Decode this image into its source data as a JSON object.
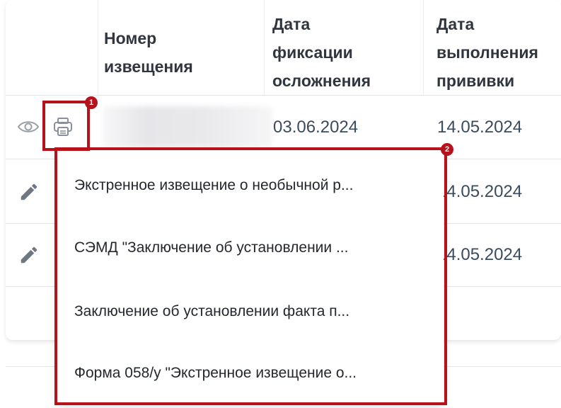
{
  "table": {
    "headers": {
      "number": [
        "Номер",
        "извещения"
      ],
      "fix_date": [
        "Дата",
        "фиксации",
        "осложнения"
      ],
      "vacc_date": [
        "Дата",
        "выполнения",
        "прививки"
      ]
    },
    "rows": [
      {
        "fix_date": "03.06.2024",
        "vacc_date": "14.05.2024"
      },
      {
        "vacc_date": "14.05.2024"
      },
      {
        "vacc_date": "14.05.2024"
      }
    ]
  },
  "callouts": {
    "one": "1",
    "two": "2"
  },
  "print_menu": {
    "items": [
      "Экстренное извещение о необычной р...",
      "СЭМД \"Заключение об установлении ...",
      "Заключение об установлении факта п...",
      "Форма 058/у \"Экстренное извещение о..."
    ]
  },
  "colors": {
    "callout": "#b5121b",
    "icon": "#8a9099"
  }
}
